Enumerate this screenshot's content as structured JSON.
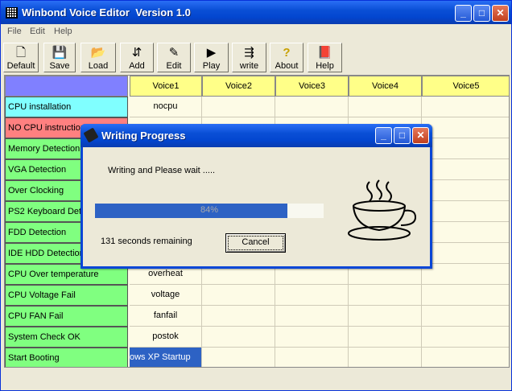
{
  "window": {
    "title": "Winbond Voice Editor  Version 1.0",
    "icon": "grid-icon"
  },
  "menu": [
    "File",
    "Edit",
    "Help"
  ],
  "toolbar": [
    {
      "label": "Default",
      "icon": "new-document-icon"
    },
    {
      "label": "Save",
      "icon": "floppy-disk-icon"
    },
    {
      "label": "Load",
      "icon": "open-folder-icon"
    },
    {
      "label": "Add",
      "icon": "add-icon"
    },
    {
      "label": "Edit",
      "icon": "edit-pen-icon"
    },
    {
      "label": "Play",
      "icon": "play-icon"
    },
    {
      "label": "write",
      "icon": "write-icon"
    },
    {
      "label": "About",
      "icon": "question-icon"
    },
    {
      "label": "Help",
      "icon": "help-book-icon"
    }
  ],
  "grid": {
    "columns": [
      "Voice1",
      "Voice2",
      "Voice3",
      "Voice4",
      "Voice5"
    ],
    "rows": [
      {
        "label": "CPU installation",
        "voice1": "nocpu",
        "color": "#80ffff"
      },
      {
        "label": "NO CPU instruction",
        "voice1": "",
        "color": "#ff8080"
      },
      {
        "label": "Memory Detection",
        "voice1": "",
        "color": "#80ff80"
      },
      {
        "label": "VGA Detection",
        "voice1": "",
        "color": "#80ff80"
      },
      {
        "label": "Over Clocking",
        "voice1": "",
        "color": "#80ff80"
      },
      {
        "label": "PS2 Keyboard Detection",
        "voice1": "",
        "color": "#80ff80"
      },
      {
        "label": "FDD Detection",
        "voice1": "",
        "color": "#80ff80"
      },
      {
        "label": "IDE HDD Detection",
        "voice1": "",
        "color": "#80ff80"
      },
      {
        "label": "CPU Over temperature",
        "voice1": "overheat",
        "color": "#80ff80"
      },
      {
        "label": "CPU Voltage Fail",
        "voice1": "voltage",
        "color": "#80ff80"
      },
      {
        "label": "CPU FAN Fail",
        "voice1": "fanfail",
        "color": "#80ff80"
      },
      {
        "label": "System Check OK",
        "voice1": "postok",
        "color": "#80ff80"
      },
      {
        "label": "Start Booting",
        "voice1": "ows XP Startup",
        "color": "#80ff80",
        "selected": true
      }
    ]
  },
  "dialog": {
    "title": "Writing Progress",
    "message": "Writing and Please wait .....",
    "progress_percent": 84,
    "progress_text": "84%",
    "remaining": "131  seconds remaining",
    "cancel_label": "Cancel",
    "image": "coffee-cup-icon"
  },
  "colors": {
    "header_yellow": "#ffff88",
    "header_corner": "#8080ff",
    "progress_blue": "#2d62c4",
    "selected_cell": "#2d62c4"
  }
}
